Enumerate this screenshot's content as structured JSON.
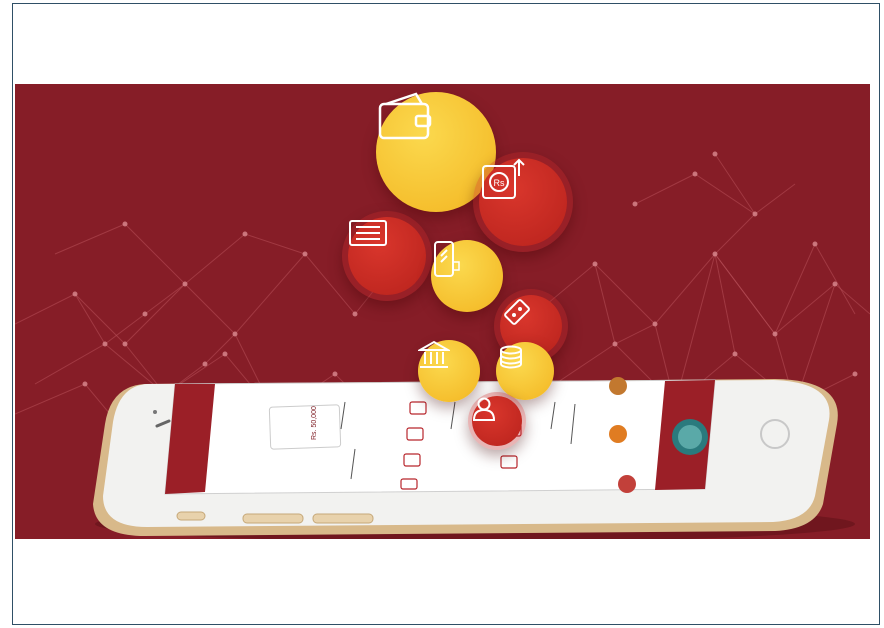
{
  "hero": {
    "background_color": "#861d27",
    "accent_yellow": "#f5c02b",
    "accent_red": "#c62a22",
    "card_text": "Rs. 50,000"
  },
  "floating_icons": [
    {
      "name": "wallet-icon",
      "tone": "yellow"
    },
    {
      "name": "rupee-withdraw-icon",
      "tone": "red",
      "label": "Rs"
    },
    {
      "name": "ticket-icon",
      "tone": "red"
    },
    {
      "name": "mobile-recharge-icon",
      "tone": "yellow"
    },
    {
      "name": "coupon-icon",
      "tone": "red"
    },
    {
      "name": "bank-icon",
      "tone": "yellow"
    },
    {
      "name": "coins-icon",
      "tone": "yellow"
    },
    {
      "name": "user-icon",
      "tone": "red"
    }
  ]
}
